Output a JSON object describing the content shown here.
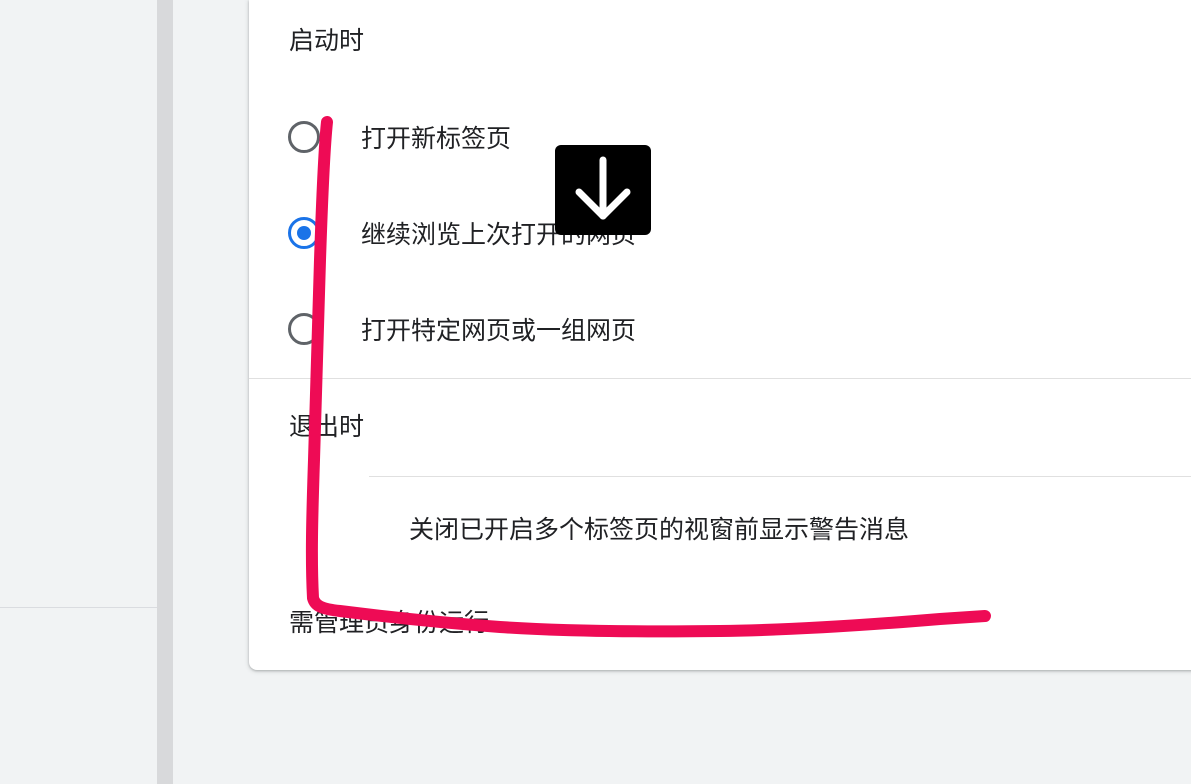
{
  "startup": {
    "title": "启动时",
    "options": [
      {
        "label": "打开新标签页",
        "checked": false
      },
      {
        "label": "继续浏览上次打开的网页",
        "checked": true
      },
      {
        "label": "打开特定网页或一组网页",
        "checked": false
      }
    ]
  },
  "exit": {
    "title": "退出时",
    "warn_label": "关闭已开启多个标签页的视窗前显示警告消息"
  },
  "admin": {
    "title": "需管理员身份运行"
  },
  "overlay": {
    "icon": "arrow-down-icon",
    "annotation_color": "#ee0b55"
  },
  "colors": {
    "accent": "#1a73e8",
    "text": "#202124"
  }
}
